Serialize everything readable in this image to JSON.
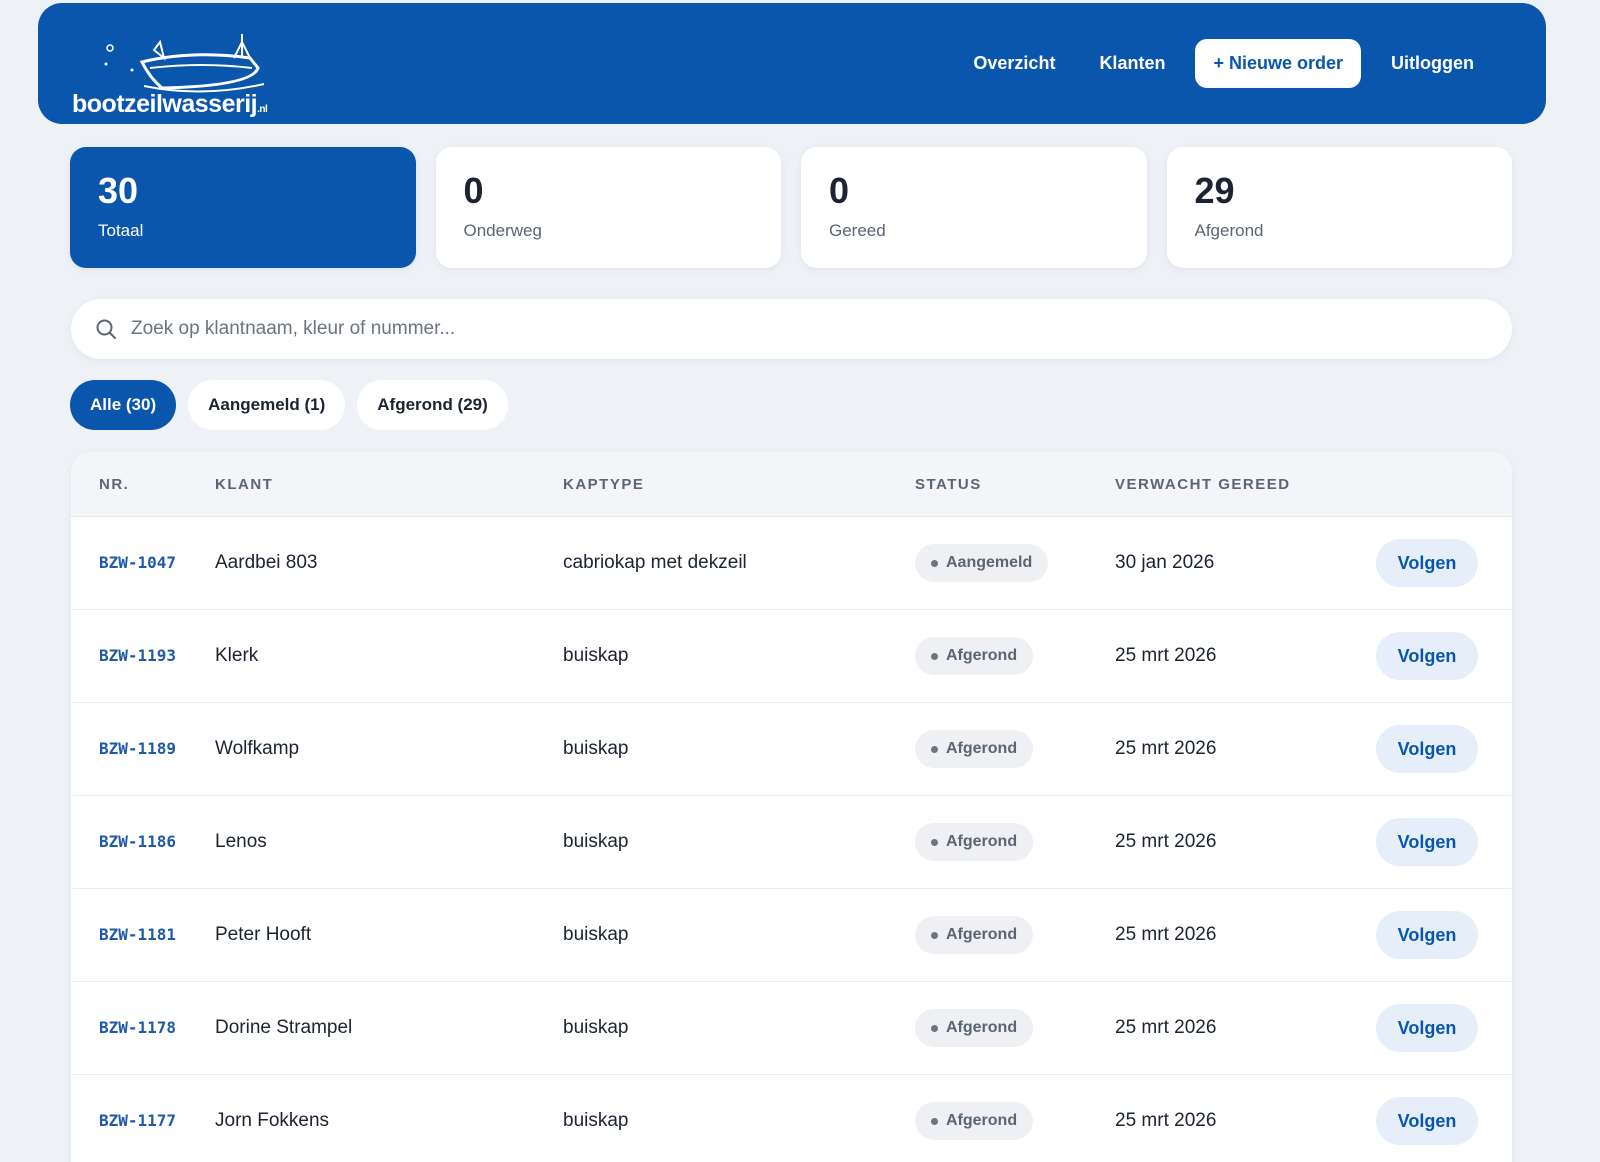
{
  "header": {
    "logo_text": "bootzeilwasserij",
    "logo_suffix": ".nl",
    "nav": {
      "overview": "Overzicht",
      "customers": "Klanten",
      "new_order": "+ Nieuwe order",
      "logout": "Uitloggen"
    }
  },
  "stats": [
    {
      "value": "30",
      "label": "Totaal"
    },
    {
      "value": "0",
      "label": "Onderweg"
    },
    {
      "value": "0",
      "label": "Gereed"
    },
    {
      "value": "29",
      "label": "Afgerond"
    }
  ],
  "search": {
    "placeholder": "Zoek op klantnaam, kleur of nummer..."
  },
  "filters": [
    "Alle (30)",
    "Aangemeld (1)",
    "Afgerond (29)"
  ],
  "table": {
    "headers": {
      "nr": "NR.",
      "klant": "KLANT",
      "kaptype": "KAPTYPE",
      "status": "STATUS",
      "gereed": "VERWACHT GEREED"
    },
    "action_label": "Volgen",
    "rows": [
      {
        "nr": "BZW-1047",
        "klant": "Aardbei 803",
        "kaptype": "cabriokap met dekzeil",
        "status": "Aangemeld",
        "gereed": "30 jan 2026"
      },
      {
        "nr": "BZW-1193",
        "klant": "Klerk",
        "kaptype": "buiskap",
        "status": "Afgerond",
        "gereed": "25 mrt 2026"
      },
      {
        "nr": "BZW-1189",
        "klant": "Wolfkamp",
        "kaptype": "buiskap",
        "status": "Afgerond",
        "gereed": "25 mrt 2026"
      },
      {
        "nr": "BZW-1186",
        "klant": "Lenos",
        "kaptype": "buiskap",
        "status": "Afgerond",
        "gereed": "25 mrt 2026"
      },
      {
        "nr": "BZW-1181",
        "klant": "Peter Hooft",
        "kaptype": "buiskap",
        "status": "Afgerond",
        "gereed": "25 mrt 2026"
      },
      {
        "nr": "BZW-1178",
        "klant": "Dorine Strampel",
        "kaptype": "buiskap",
        "status": "Afgerond",
        "gereed": "25 mrt 2026"
      },
      {
        "nr": "BZW-1177",
        "klant": "Jorn Fokkens",
        "kaptype": "buiskap",
        "status": "Afgerond",
        "gereed": "25 mrt 2026"
      }
    ]
  }
}
